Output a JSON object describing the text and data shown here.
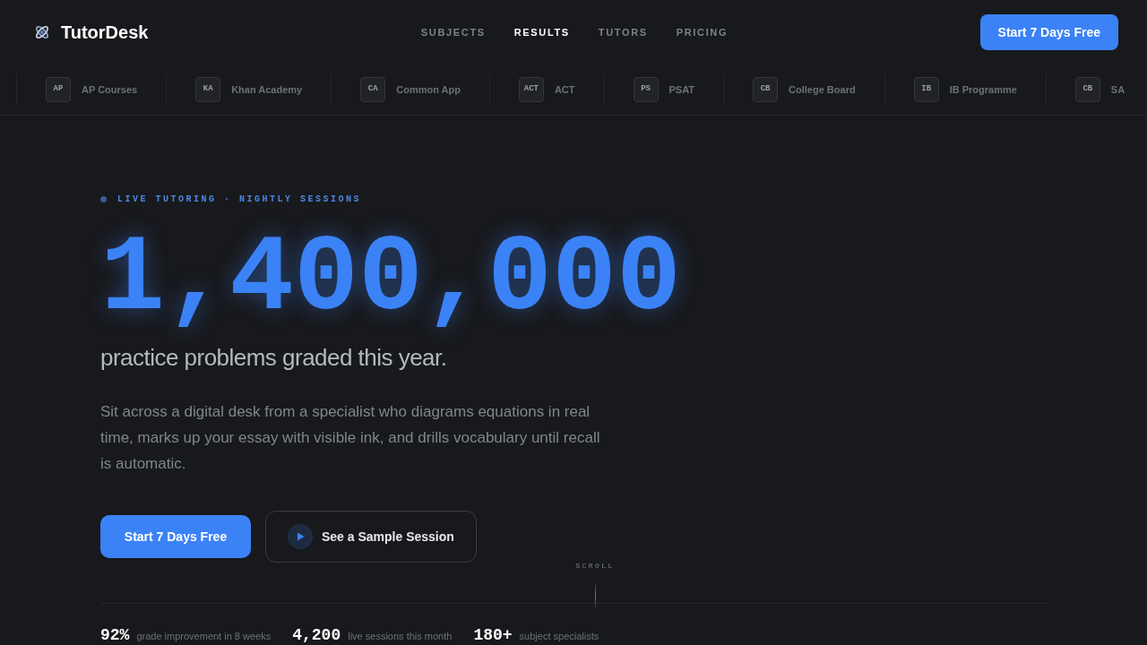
{
  "brand": {
    "name": "TutorDesk"
  },
  "nav": [
    {
      "label": "SUBJECTS",
      "selected": false
    },
    {
      "label": "RESULTS",
      "selected": true
    },
    {
      "label": "TUTORS",
      "selected": false
    },
    {
      "label": "PRICING",
      "selected": false
    }
  ],
  "header_cta": "Start 7 Days Free",
  "partners": [
    {
      "abbr": "AP",
      "name": "AP Courses"
    },
    {
      "abbr": "KA",
      "name": "Khan Academy"
    },
    {
      "abbr": "CA",
      "name": "Common App"
    },
    {
      "abbr": "ACT",
      "name": "ACT"
    },
    {
      "abbr": "PS",
      "name": "PSAT"
    },
    {
      "abbr": "CB",
      "name": "College Board"
    },
    {
      "abbr": "IB",
      "name": "IB Programme"
    },
    {
      "abbr": "CB",
      "name": "SA"
    }
  ],
  "hero": {
    "eyebrow": "LIVE TUTORING · NIGHTLY SESSIONS",
    "big_number": "1,400,000",
    "subtitle": "practice problems graded this year.",
    "body": "Sit across a digital desk from a specialist who diagrams equations in real time, marks up your essay with visible ink, and drills vocabulary until recall is automatic.",
    "primary_button": "Start 7 Days Free",
    "secondary_button": "See a Sample Session",
    "scroll_label": "SCROLL"
  },
  "stats": [
    {
      "value": "92%",
      "label": "grade improvement in 8 weeks"
    },
    {
      "value": "4,200",
      "label": "live sessions this month"
    },
    {
      "value": "180+",
      "label": "subject specialists"
    }
  ]
}
